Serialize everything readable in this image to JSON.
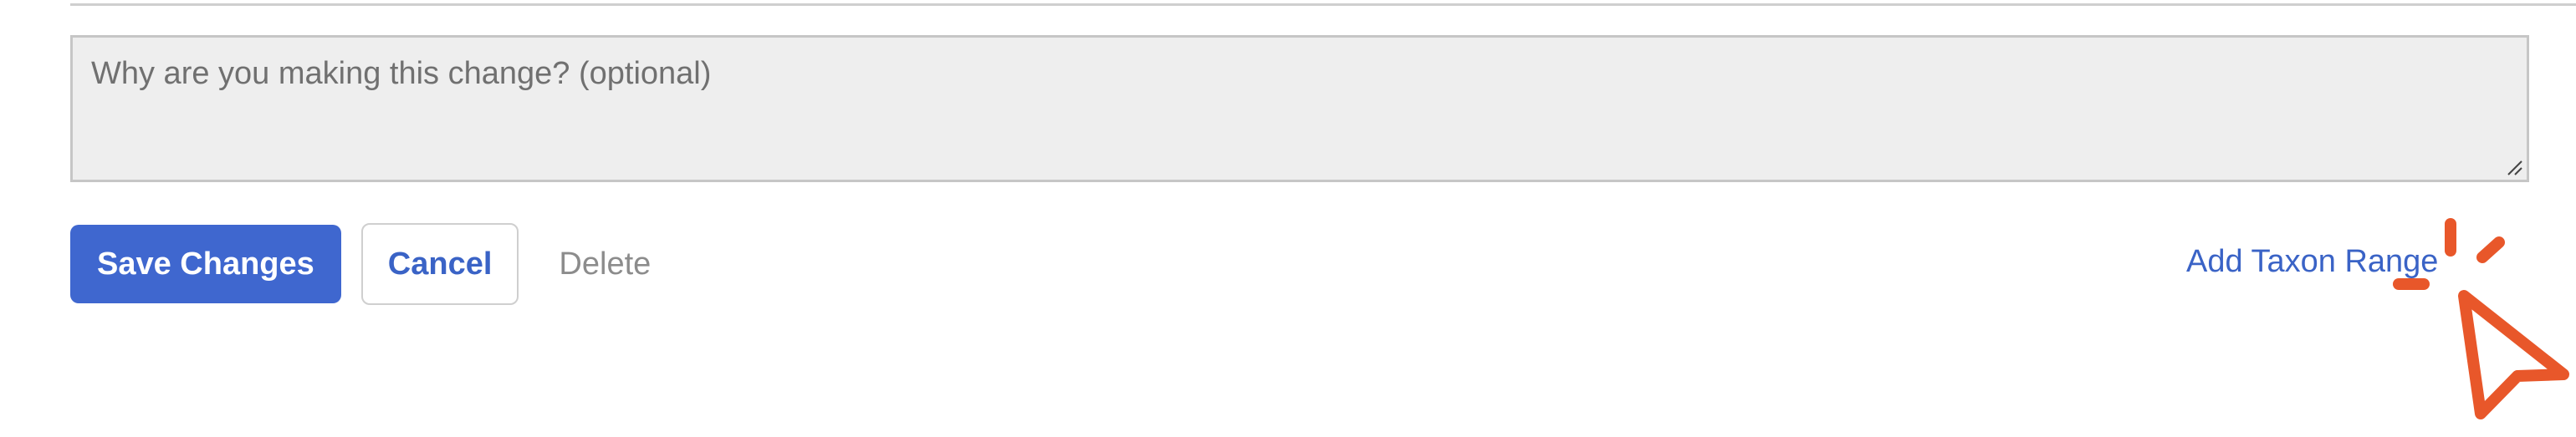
{
  "reason_field": {
    "placeholder": "Why are you making this change? (optional)",
    "value": ""
  },
  "actions": {
    "save_label": "Save Changes",
    "cancel_label": "Cancel",
    "delete_label": "Delete"
  },
  "add_taxon_range_label": "Add Taxon Range",
  "icons": {
    "resize_grip": "resize-grip-icon",
    "cursor": "click-cursor-icon"
  },
  "colors": {
    "primary": "#3f67cf",
    "link": "#3a63c6",
    "muted": "#8c8c8c",
    "cursor": "#e8572a",
    "field_bg": "#eeeeee"
  }
}
